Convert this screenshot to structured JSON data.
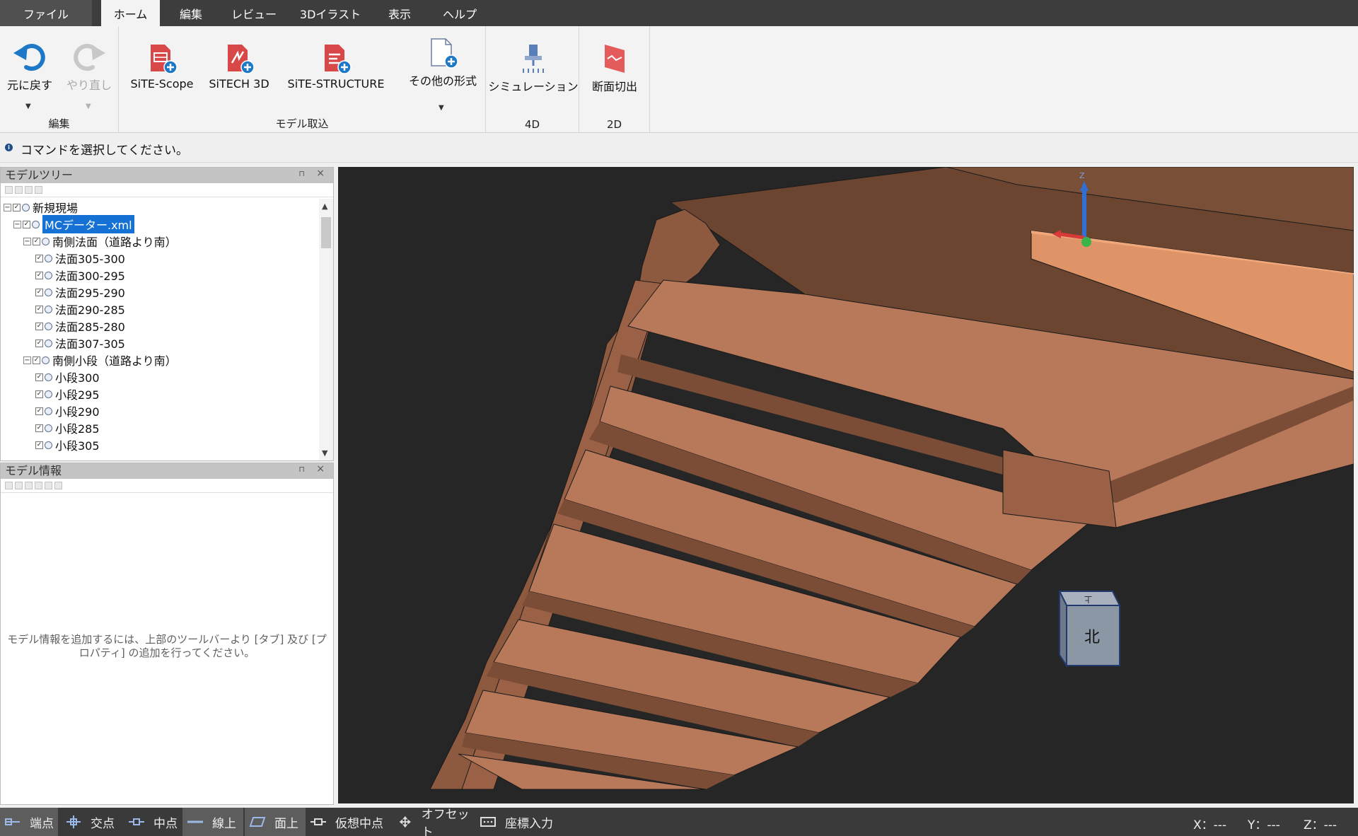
{
  "menu": {
    "file": "ファイル",
    "tabs": [
      "ホーム",
      "編集",
      "レビュー",
      "3Dイラスト",
      "表示",
      "ヘルプ"
    ],
    "active_tab": "ホーム"
  },
  "ribbon": {
    "groups": {
      "edit": "編集",
      "import": "モデル取込",
      "g4d": "4D",
      "g2d": "2D"
    },
    "buttons": {
      "undo": "元に戻す",
      "redo": "やり直し",
      "site_scope": "SiTE-Scope",
      "sitech3d": "SiTECH 3D",
      "site_structure": "SiTE-STRUCTURE",
      "other_formats": "その他の形式",
      "simulation": "シミュレーション",
      "section_cut": "断面切出"
    }
  },
  "command_bar": {
    "text": "コマンドを選択してください。"
  },
  "model_tree": {
    "title": "モデルツリー",
    "items": [
      {
        "label": "新規現場",
        "depth": 0,
        "expander": "−"
      },
      {
        "label": "MCデーター.xml",
        "depth": 1,
        "expander": "−",
        "selected": true
      },
      {
        "label": "南側法面（道路より南）",
        "depth": 2,
        "expander": "−"
      },
      {
        "label": "法面305-300",
        "depth": 3,
        "expander": ""
      },
      {
        "label": "法面300-295",
        "depth": 3,
        "expander": ""
      },
      {
        "label": "法面295-290",
        "depth": 3,
        "expander": ""
      },
      {
        "label": "法面290-285",
        "depth": 3,
        "expander": ""
      },
      {
        "label": "法面285-280",
        "depth": 3,
        "expander": ""
      },
      {
        "label": "法面307-305",
        "depth": 3,
        "expander": ""
      },
      {
        "label": "南側小段（道路より南）",
        "depth": 2,
        "expander": "−"
      },
      {
        "label": "小段300",
        "depth": 3,
        "expander": ""
      },
      {
        "label": "小段295",
        "depth": 3,
        "expander": ""
      },
      {
        "label": "小段290",
        "depth": 3,
        "expander": ""
      },
      {
        "label": "小段285",
        "depth": 3,
        "expander": ""
      },
      {
        "label": "小段305",
        "depth": 3,
        "expander": ""
      }
    ]
  },
  "model_info": {
    "title": "モデル情報",
    "empty_message": "モデル情報を追加するには、上部のツールバーより [タブ] 及び [プロパティ] の追加を行ってください。"
  },
  "viewport": {
    "background": "#262626",
    "terrain_color": "#b8785a",
    "axis_label": "Z",
    "view_cube": {
      "front": "北",
      "top": "上"
    }
  },
  "status_bar": {
    "snaps": [
      {
        "label": "端点",
        "icon": "endpoint-snap-icon",
        "active": true
      },
      {
        "label": "交点",
        "icon": "intersection-snap-icon",
        "active": false
      },
      {
        "label": "中点",
        "icon": "midpoint-snap-icon",
        "active": false
      },
      {
        "label": "線上",
        "icon": "on-line-snap-icon",
        "active": true
      },
      {
        "label": "面上",
        "icon": "on-face-snap-icon",
        "active": true
      },
      {
        "label": "仮想中点",
        "icon": "virtual-midpoint-snap-icon",
        "active": false
      },
      {
        "label": "オフセット",
        "icon": "offset-snap-icon",
        "active": false
      },
      {
        "label": "座標入力",
        "icon": "coordinate-input-icon",
        "active": false
      }
    ],
    "coords": {
      "x": "X：---",
      "y": "Y：---",
      "z": "Z：---"
    }
  }
}
